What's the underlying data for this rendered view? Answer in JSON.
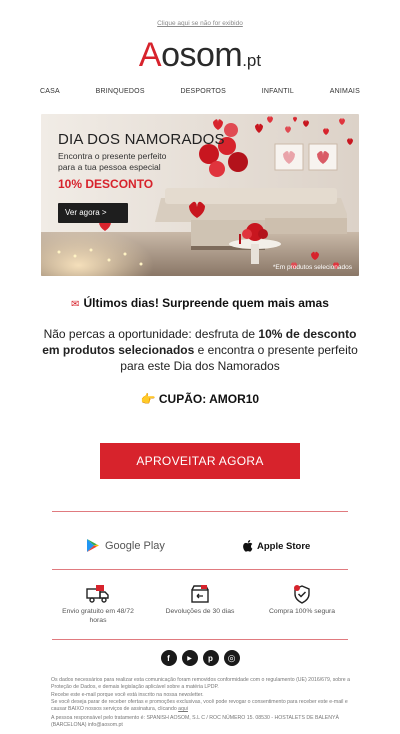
{
  "header": {
    "view_online": "Clique aqui se não for exibido",
    "logo_a": "A",
    "logo_rest": "osom",
    "logo_tld": ".pt"
  },
  "nav": {
    "items": [
      {
        "label": "CASA"
      },
      {
        "label": "BRINQUEDOS"
      },
      {
        "label": "DESPORTOS"
      },
      {
        "label": "INFANTIL"
      },
      {
        "label": "ANIMAIS"
      }
    ]
  },
  "hero": {
    "title": "DIA DOS NAMORADOS",
    "subtitle_line1": "Encontra o presente perfeito",
    "subtitle_line2": "para a tua pessoa especial",
    "discount": "10% DESCONTO",
    "button": "Ver agora >",
    "caption": "*Em produtos selecionados"
  },
  "content": {
    "headline": "Últimos dias! Surpreende quem mais amas",
    "body_pre": "Não percas a oportunidade: desfruta de ",
    "body_bold": "10% de desconto em produtos selecionados",
    "body_post": " e encontra o presente perfeito para este Dia dos Namorados",
    "coupon": "CUPÃO: AMOR10",
    "cta": "APROVEITAR AGORA"
  },
  "stores": {
    "google": "Google Play",
    "apple": "Apple Store"
  },
  "features": [
    {
      "line1": "Envio gratuito em 48/72",
      "line2": "horas"
    },
    {
      "line1": "Devoluções de 30 dias",
      "line2": ""
    },
    {
      "line1": "Compra 100% segura",
      "line2": ""
    }
  ],
  "social": {
    "facebook": "f",
    "youtube": "▶",
    "pinterest": "p",
    "instagram": "◎"
  },
  "legal": {
    "p1": "Os dados necessários para realizar esta comunicação foram removidos conformidade com o regulamento (UE) 2016/679, sobre a Proteção de Dados, e demais legislação aplicável sobre a matéria LPDP.",
    "p2": "Recebe este e-mail porque você está inscrito na nossa newsletter.",
    "p3_pre": "Se você deseja parar de receber ofertas e promoções exclusivas, você pode revogar o consentimento para receber este e-mail e causar BAIXO nossos serviços de assinatura, clicando ",
    "p3_link": "aqui",
    "p4": "A pessoa responsável pelo tratamento é: SPANISH AOSOM, S.L C / ROC NÚMERO 15. 08530 - HOSTALETS DE BALENYÀ (BARCELONA) info@aosom.pt"
  },
  "colors": {
    "brand_red": "#d7232c",
    "divider": "#e07a7f"
  }
}
